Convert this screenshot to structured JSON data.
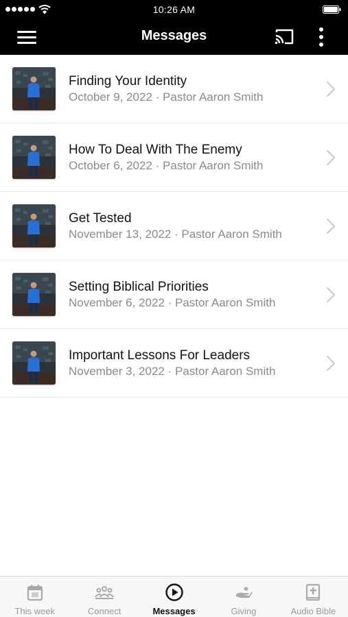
{
  "status_bar": {
    "time": "10:26 AM"
  },
  "app_bar": {
    "title": "Messages"
  },
  "messages": [
    {
      "title": "Finding Your Identity",
      "subtitle": "October 9, 2022 · Pastor Aaron Smith"
    },
    {
      "title": "How To Deal With The Enemy",
      "subtitle": "October 6, 2022 · Pastor Aaron Smith"
    },
    {
      "title": "Get Tested",
      "subtitle": "November 13, 2022 · Pastor Aaron Smith"
    },
    {
      "title": "Setting Biblical Priorities",
      "subtitle": "November 6, 2022 · Pastor Aaron Smith"
    },
    {
      "title": "Important Lessons For Leaders",
      "subtitle": "November 3, 2022 · Pastor Aaron Smith"
    }
  ],
  "tabs": [
    {
      "label": "This week",
      "icon": "calendar-icon",
      "active": false
    },
    {
      "label": "Connect",
      "icon": "people-icon",
      "active": false
    },
    {
      "label": "Messages",
      "icon": "play-circle-icon",
      "active": true
    },
    {
      "label": "Giving",
      "icon": "giving-hand-icon",
      "active": false
    },
    {
      "label": "Audio Bible",
      "icon": "bible-icon",
      "active": false
    }
  ],
  "colors": {
    "header_bg": "#000000",
    "active_tab": "#111111",
    "inactive_tab": "#9a9a9a",
    "subtitle": "#8a8a8a"
  }
}
